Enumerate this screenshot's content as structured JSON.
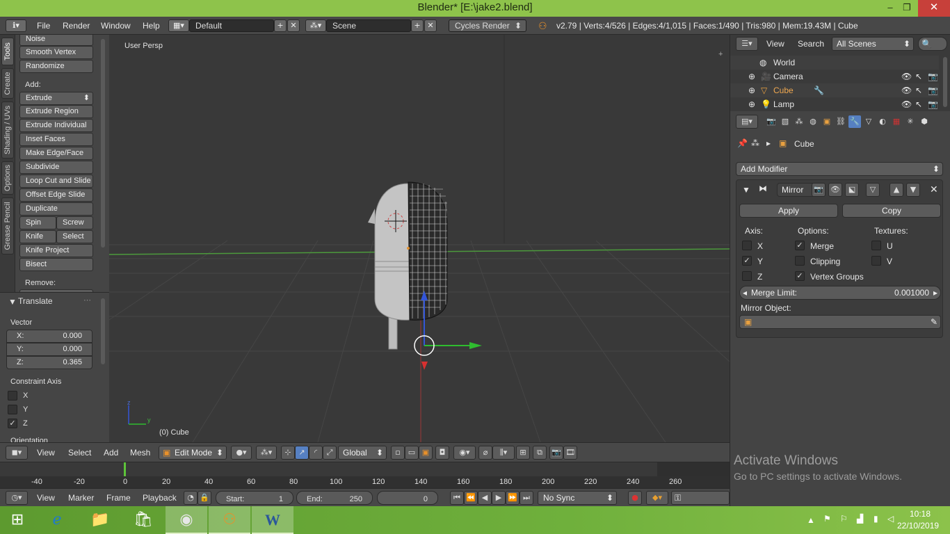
{
  "window": {
    "title": "Blender* [E:\\jake2.blend]",
    "minimize": "–",
    "maximize": "❐",
    "close": "✕"
  },
  "infobar": {
    "menus": [
      "File",
      "Render",
      "Window",
      "Help"
    ],
    "layout": "Default",
    "scene": "Scene",
    "engine": "Cycles Render",
    "stats": "v2.79 | Verts:4/526 | Edges:4/1,015 | Faces:1/490 | Tris:980 | Mem:19.43M | Cube"
  },
  "tool_tabs": [
    "Tools",
    "Create",
    "Shading / UVs",
    "Options",
    "Grease Pencil"
  ],
  "toolshelf": {
    "top_buttons": [
      "Noise",
      "Smooth Vertex",
      "Randomize"
    ],
    "add_label": "Add:",
    "extrude_dropdown": "Extrude",
    "add_buttons": [
      "Extrude Region",
      "Extrude Individual",
      "Inset Faces",
      "Make Edge/Face",
      "Subdivide",
      "Loop Cut and Slide",
      "Offset Edge Slide",
      "Duplicate"
    ],
    "spin": "Spin",
    "screw": "Screw",
    "knife": "Knife",
    "select": "Select",
    "knife_project": "Knife Project",
    "bisect": "Bisect",
    "remove_label": "Remove:"
  },
  "redo_panel": {
    "title": "Translate",
    "vector_label": "Vector",
    "x_label": "X:",
    "x_value": "0.000",
    "y_label": "Y:",
    "y_value": "0.000",
    "z_label": "Z:",
    "z_value": "0.365",
    "constraint_label": "Constraint Axis",
    "axes": [
      {
        "label": "X",
        "checked": false
      },
      {
        "label": "Y",
        "checked": false
      },
      {
        "label": "Z",
        "checked": true
      }
    ],
    "orientation_label": "Orientation"
  },
  "viewport": {
    "view_label": "User Persp",
    "object_label": "(0) Cube",
    "axis_x": "y",
    "axis_z": "z"
  },
  "viewport_header": {
    "menus": [
      "View",
      "Select",
      "Add",
      "Mesh"
    ],
    "mode": "Edit Mode",
    "orientation": "Global"
  },
  "timeline": {
    "ticks": [
      "-40",
      "-20",
      "0",
      "20",
      "40",
      "60",
      "80",
      "100",
      "120",
      "140",
      "160",
      "180",
      "200",
      "220",
      "240",
      "260"
    ],
    "current_frame": 0,
    "menus": [
      "View",
      "Marker",
      "Frame",
      "Playback"
    ],
    "start_label": "Start:",
    "start_value": "1",
    "end_label": "End:",
    "end_value": "250",
    "frame_value": "0",
    "sync": "No Sync"
  },
  "outliner": {
    "view": "View",
    "search": "Search",
    "scenes": "All Scenes",
    "items": [
      "World",
      "Camera",
      "Cube",
      "Lamp"
    ]
  },
  "properties": {
    "breadcrumb": "Cube",
    "add_modifier": "Add Modifier",
    "modifier_name": "Mirror",
    "apply": "Apply",
    "copy": "Copy",
    "axis_label": "Axis:",
    "options_label": "Options:",
    "textures_label": "Textures:",
    "axis": [
      {
        "label": "X",
        "checked": false
      },
      {
        "label": "Y",
        "checked": true
      },
      {
        "label": "Z",
        "checked": false
      }
    ],
    "options": [
      {
        "label": "Merge",
        "checked": true
      },
      {
        "label": "Clipping",
        "checked": false
      },
      {
        "label": "Vertex Groups",
        "checked": true
      }
    ],
    "textures": [
      {
        "label": "U",
        "checked": false
      },
      {
        "label": "V",
        "checked": false
      }
    ],
    "merge_limit_label": "Merge Limit:",
    "merge_limit_value": "0.001000",
    "mirror_object_label": "Mirror Object:"
  },
  "watermark": {
    "line1": "Activate Windows",
    "line2": "Go to PC settings to activate Windows."
  },
  "taskbar": {
    "time": "10:18",
    "date": "22/10/2019"
  },
  "colors": {
    "title_bar": "#8ec34b",
    "close_button": "#c7403a",
    "panel": "#454545",
    "viewport_bg": "#393939",
    "selection_blue": "#5680c2",
    "current_frame": "#5ec43a"
  }
}
